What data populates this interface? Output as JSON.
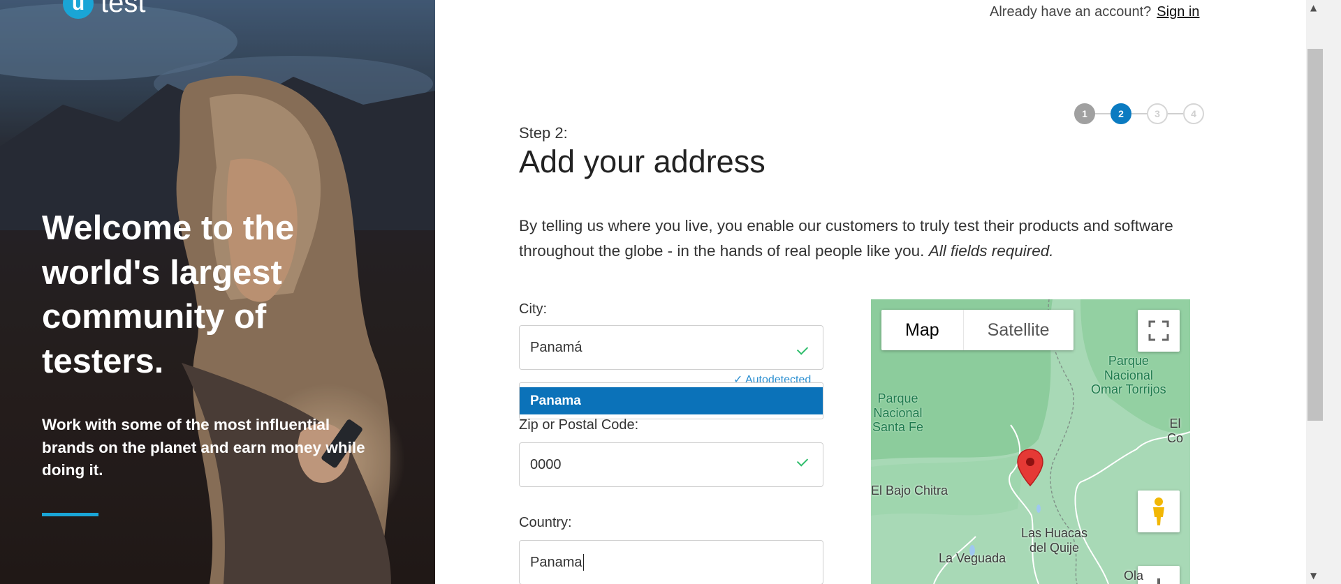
{
  "brand": {
    "logo_mark": "u",
    "logo_text": "test",
    "accent": "#1aa5d6"
  },
  "hero": {
    "title": "Welcome to the world's largest community of testers.",
    "subtitle": "Work with some of the most influential brands on the planet and earn money while doing it."
  },
  "header": {
    "have_account": "Already have an account?",
    "sign_in": "Sign in"
  },
  "stepper": {
    "steps": [
      "1",
      "2",
      "3",
      "4"
    ],
    "current": 2
  },
  "form": {
    "step_label": "Step 2:",
    "title": "Add your address",
    "intro": "By telling us where you live, you enable our customers to truly test their products and software throughout the globe - in the hands of real people like you.",
    "intro_required": "All fields required.",
    "city": {
      "label": "City:",
      "value": "Panamá",
      "hint": "✓ Autodetected"
    },
    "city_suggestion": "Panama",
    "zip": {
      "label": "Zip or Postal Code:",
      "value": "0000"
    },
    "country": {
      "label": "Country:",
      "value": "Panama"
    }
  },
  "map": {
    "types": [
      "Map",
      "Satellite"
    ],
    "selected_type": "Map",
    "labels": {
      "parque_santa_fe": "Parque\nNacional\nSanta Fe",
      "parque_torrijos": "Parque\nNacional\nOmar Torrijos",
      "el_co": "El Co",
      "bajo_chitra": "El Bajo Chitra",
      "las_huacas": "Las Huacas\ndel Quije",
      "la_veguada": "La Veguada",
      "ola": "Ola"
    },
    "colors": {
      "land": "#a8d9b6",
      "forest": "#8ccc9c",
      "road": "#ffffff",
      "marker": "#e53935"
    }
  }
}
